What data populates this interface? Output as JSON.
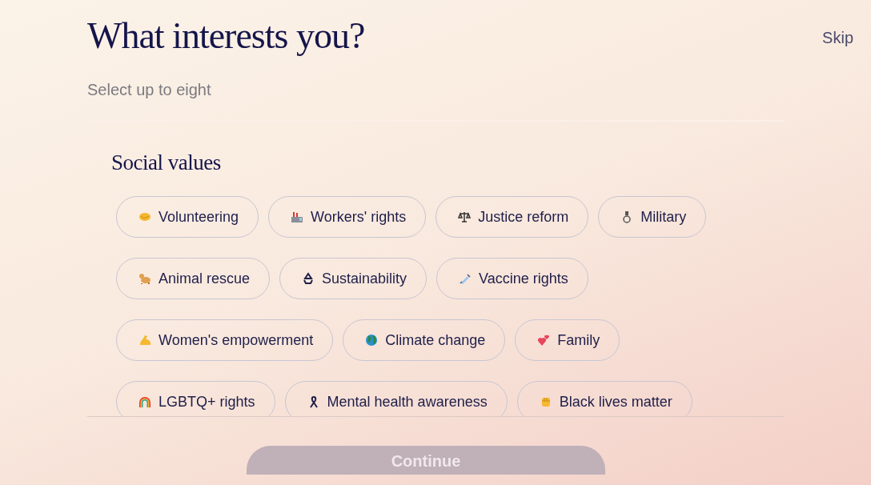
{
  "title": "What interests you?",
  "skip": "Skip",
  "subtitle": "Select up to eight",
  "section": {
    "title": "Social values",
    "chips": [
      {
        "label": "Volunteering",
        "selected": false
      },
      {
        "label": "Workers' rights",
        "selected": false
      },
      {
        "label": "Justice reform",
        "selected": false
      },
      {
        "label": "Military",
        "selected": false
      },
      {
        "label": "Animal rescue",
        "selected": false
      },
      {
        "label": "Sustainability",
        "selected": false
      },
      {
        "label": "Vaccine rights",
        "selected": false
      },
      {
        "label": "Women's empowerment",
        "selected": false
      },
      {
        "label": "Climate change",
        "selected": false
      },
      {
        "label": "Family",
        "selected": false
      },
      {
        "label": "LGBTQ+ rights",
        "selected": false
      },
      {
        "label": "Mental health awareness",
        "selected": false
      },
      {
        "label": "Black lives matter",
        "selected": false
      }
    ]
  },
  "continue_button": {
    "label": "Continue",
    "disabled": true
  }
}
